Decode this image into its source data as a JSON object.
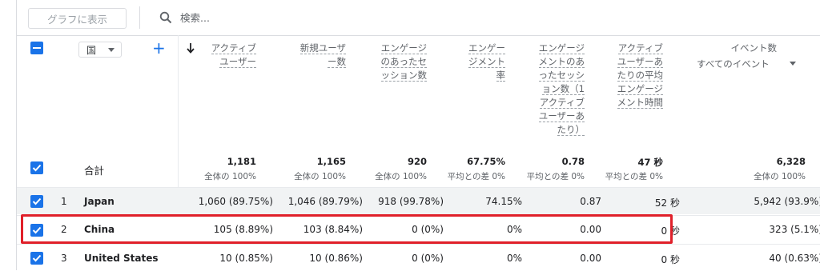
{
  "toolbar": {
    "graph_button": "グラフに表示",
    "search_placeholder": "検索..."
  },
  "header": {
    "dimension": "国",
    "columns": [
      {
        "lines": [
          "アクティブ",
          "ユーザー"
        ]
      },
      {
        "lines": [
          "新規ユーザ",
          "ー数"
        ]
      },
      {
        "lines": [
          "エンゲージ",
          "のあったセ",
          "ッション数"
        ]
      },
      {
        "lines": [
          "エンゲー",
          "ジメント",
          "率"
        ]
      },
      {
        "lines": [
          "エンゲージ",
          "メントのあ",
          "ったセッシ",
          "ョン数（1",
          "アクティブ",
          "ユーザーあ",
          "たり）"
        ]
      },
      {
        "lines": [
          "アクティブ",
          "ユーザーあ",
          "たりの平均",
          "エンゲージ",
          "メント時間"
        ]
      },
      {
        "lines": [
          "イベント数"
        ]
      }
    ],
    "events_filter": "すべてのイベント"
  },
  "totals": {
    "label": "合計",
    "values": [
      "1,181",
      "1,165",
      "920",
      "67.75%",
      "0.78",
      "47 秒",
      "6,328"
    ],
    "subs": [
      "全体の 100%",
      "全体の 100%",
      "全体の 100%",
      "平均との差 0%",
      "平均との差 0%",
      "平均との差 0%",
      "全体の 100%"
    ]
  },
  "rows": [
    {
      "rank": "1",
      "country": "Japan",
      "values": [
        "1,060 (89.75%)",
        "1,046 (89.79%)",
        "918 (99.78%)",
        "74.15%",
        "0.87",
        "52 秒",
        "5,942 (93.9%)"
      ]
    },
    {
      "rank": "2",
      "country": "China",
      "values": [
        "105 (8.89%)",
        "103 (8.84%)",
        "0 (0%)",
        "0%",
        "0.00",
        "0 秒",
        "323 (5.1%)"
      ]
    },
    {
      "rank": "3",
      "country": "United States",
      "values": [
        "10 (0.85%)",
        "10 (0.86%)",
        "0 (0%)",
        "0%",
        "0.00",
        "0 秒",
        "40 (0.63%)"
      ]
    }
  ],
  "colors": {
    "accent": "#1a73e8",
    "highlight": "#e0202a"
  }
}
